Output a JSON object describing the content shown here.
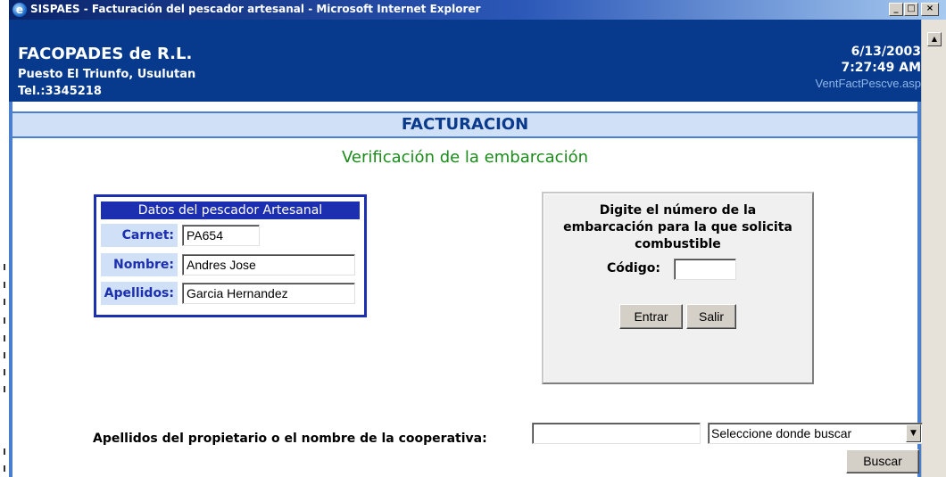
{
  "window": {
    "title": "SISPAES - Facturación del pescador artesanal - Microsoft Internet Explorer",
    "minimize": "_",
    "maximize": "□",
    "close": "×"
  },
  "header": {
    "company": "FACOPADES de R.L.",
    "address": "Puesto El Triunfo, Usulutan",
    "phone": "Tel.:3345218",
    "date": "6/13/2003",
    "time": "7:27:49 AM",
    "page_file": "VentFactPescve.asp"
  },
  "page": {
    "section_title": "FACTURACION",
    "subtitle": "Verificación de la embarcación"
  },
  "fisherman": {
    "title": "Datos del pescador Artesanal",
    "fields": [
      {
        "label": "Carnet:",
        "value": "PA654"
      },
      {
        "label": "Nombre:",
        "value": "Andres Jose"
      },
      {
        "label": "Apellidos:",
        "value": "Garcia Hernandez"
      }
    ]
  },
  "boat": {
    "instructions_line1": "Digite el número de la",
    "instructions_line2": "embarcación para la que solicita",
    "instructions_line3": "combustible",
    "code_label": "Código:",
    "code_value": "",
    "enter_label": "Entrar",
    "exit_label": "Salir"
  },
  "search": {
    "label": "Apellidos del propietario o el nombre de la cooperativa:",
    "value": "",
    "select_value": "Seleccione donde buscar",
    "button_label": "Buscar"
  },
  "icons": {
    "browser": "ie-icon",
    "scroll_up": "arrow-up-icon",
    "dropdown": "chevron-down-icon"
  },
  "colors": {
    "header_bg": "#073a8d",
    "frame_accent": "#4a7fd0",
    "section_bg": "#cfe0f7",
    "subtitle": "#1a8a1a",
    "box_border": "#1c2fb0"
  }
}
